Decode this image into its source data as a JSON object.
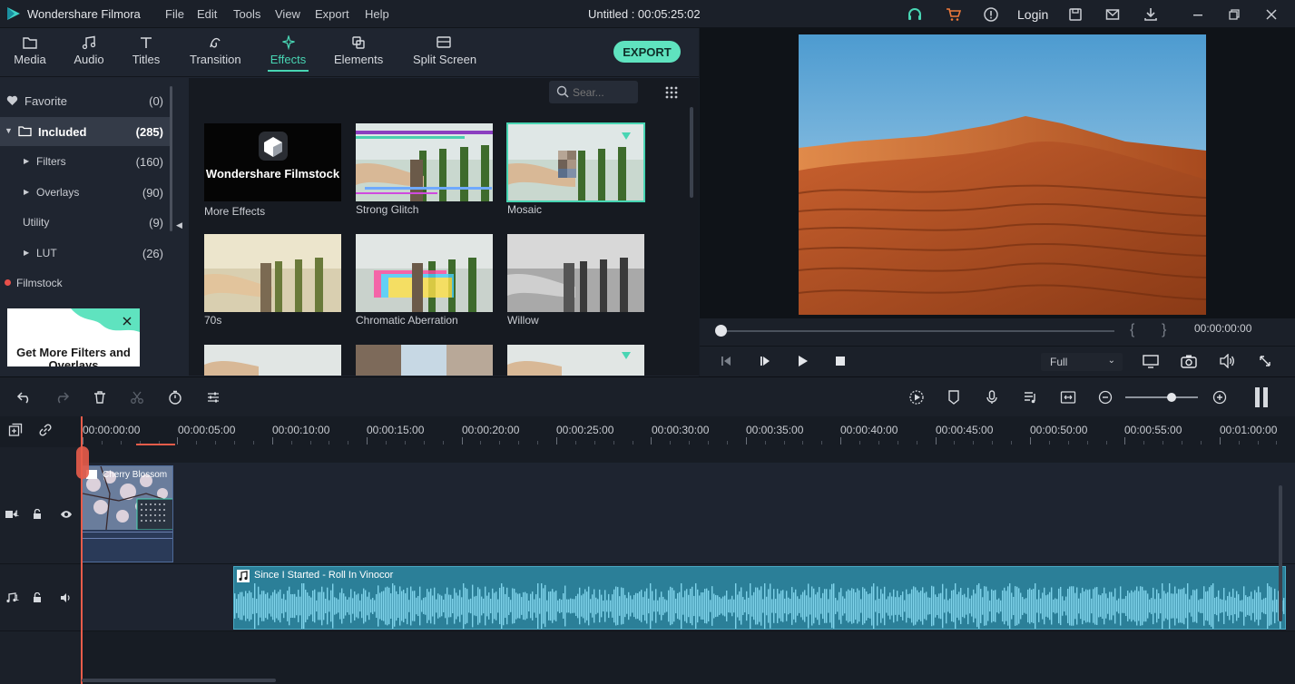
{
  "app": {
    "name": "Wondershare Filmora",
    "doc_title": "Untitled : 00:05:25:02",
    "login_label": "Login"
  },
  "menu": [
    "File",
    "Edit",
    "Tools",
    "View",
    "Export",
    "Help"
  ],
  "tabs": [
    {
      "label": "Media",
      "icon": "folder-icon"
    },
    {
      "label": "Audio",
      "icon": "music-note-icon"
    },
    {
      "label": "Titles",
      "icon": "text-t-icon"
    },
    {
      "label": "Transition",
      "icon": "transition-icon"
    },
    {
      "label": "Effects",
      "icon": "effects-sparkle-icon",
      "active": true
    },
    {
      "label": "Elements",
      "icon": "elements-icon"
    },
    {
      "label": "Split Screen",
      "icon": "split-screen-icon"
    }
  ],
  "export_label": "EXPORT",
  "sidebar": {
    "favorite": {
      "label": "Favorite",
      "count": "(0)"
    },
    "included": {
      "label": "Included",
      "count": "(285)"
    },
    "filters": {
      "label": "Filters",
      "count": "(160)"
    },
    "overlays": {
      "label": "Overlays",
      "count": "(90)"
    },
    "utility": {
      "label": "Utility",
      "count": "(9)"
    },
    "lut": {
      "label": "LUT",
      "count": "(26)"
    },
    "filmstock": {
      "label": "Filmstock"
    },
    "ad_text": "Get More Filters and Overlays"
  },
  "search": {
    "placeholder": "Sear..."
  },
  "effects": {
    "filmstock_logo_text": "Wondershare Filmstock",
    "items": [
      "More Effects",
      "Strong Glitch",
      "Mosaic",
      "70s",
      "Chromatic Aberration",
      "Willow"
    ]
  },
  "preview": {
    "timecode": "00:00:00:00",
    "quality": "Full",
    "brace_open": "{",
    "brace_close": "}"
  },
  "ruler": [
    "00:00:00:00",
    "00:00:05:00",
    "00:00:10:00",
    "00:00:15:00",
    "00:00:20:00",
    "00:00:25:00",
    "00:00:30:00",
    "00:00:35:00",
    "00:00:40:00",
    "00:00:45:00",
    "00:00:50:00",
    "00:00:55:00",
    "00:01:00:00"
  ],
  "timeline": {
    "video_clip_name": "Cherry Blossom",
    "audio_clip_name": "Since I Started - Roll In Vinocor",
    "video_track_label": "1",
    "audio_track_label": "1"
  },
  "colors": {
    "accent": "#48d5b3",
    "export": "#5fe3bf",
    "playhead": "#e85c4a",
    "audio_clip": "#2b7f98"
  }
}
